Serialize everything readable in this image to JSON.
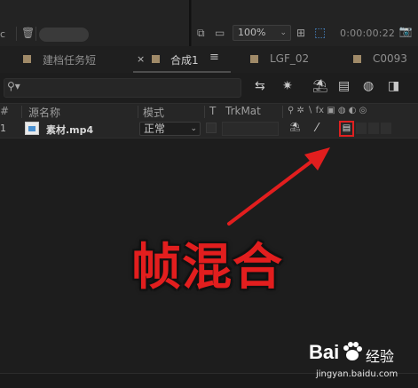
{
  "top_bar": {
    "left_fragment": "c",
    "zoom": "100%",
    "timecode": "0:00:00:22"
  },
  "tabs": [
    {
      "label": "建档任务短"
    },
    {
      "label": "合成1",
      "active": true
    },
    {
      "label": "LGF_02"
    },
    {
      "label": "C0093"
    }
  ],
  "timeline": {
    "headers": {
      "num": "#",
      "source_name": "源名称",
      "mode": "模式",
      "t": "T",
      "trkmat": "TrkMat",
      "switches": "⚲ ✲ ∖ fx ▣ ◍ ◐ ◎"
    },
    "layer": {
      "number": "1",
      "name": "素材.mp4",
      "mode": "正常"
    }
  },
  "annotation": {
    "text": "帧混合",
    "color": "#e21e1e"
  },
  "watermark": {
    "brand": "Bai",
    "site": "经验",
    "url": "jingyan.baidu.com"
  },
  "colors": {
    "panel_bg": "#1d1d1d",
    "header_bg": "#262626",
    "tab_swatch": "#a08a68",
    "highlight": "#e02020"
  }
}
